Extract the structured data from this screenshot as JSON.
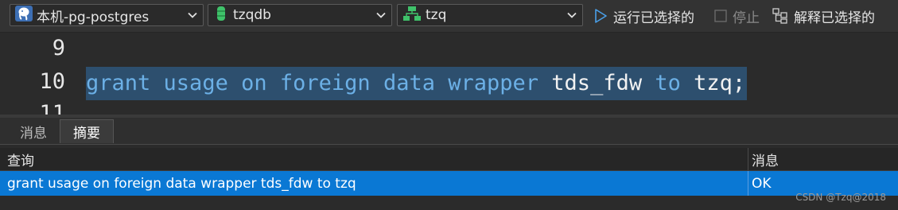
{
  "toolbar": {
    "connection": {
      "label": "本机-pg-postgres",
      "icon": "postgres-elephant-icon"
    },
    "database": {
      "label": "tzqdb",
      "icon": "database-icon",
      "icon_color": "#3fc26a"
    },
    "schema": {
      "label": "tzq",
      "icon": "schema-icon",
      "icon_color": "#3fc26a"
    },
    "run_selected_label": "运行已选择的",
    "stop_label": "停止",
    "explain_selected_label": "解释已选择的"
  },
  "editor": {
    "lines": [
      {
        "number": "9",
        "text": ""
      },
      {
        "number": "10",
        "text": "grant usage on foreign data wrapper tds_fdw to tzq;"
      },
      {
        "number": "11",
        "text": ""
      }
    ],
    "tokens": [
      {
        "text": "grant",
        "kind": "keyword"
      },
      {
        "text": " ",
        "kind": "space"
      },
      {
        "text": "usage",
        "kind": "keyword"
      },
      {
        "text": " ",
        "kind": "space"
      },
      {
        "text": "on",
        "kind": "keyword"
      },
      {
        "text": " ",
        "kind": "space"
      },
      {
        "text": "foreign",
        "kind": "keyword"
      },
      {
        "text": " ",
        "kind": "space"
      },
      {
        "text": "data",
        "kind": "keyword"
      },
      {
        "text": " ",
        "kind": "space"
      },
      {
        "text": "wrapper",
        "kind": "keyword"
      },
      {
        "text": " ",
        "kind": "space"
      },
      {
        "text": "tds_fdw",
        "kind": "identifier"
      },
      {
        "text": " ",
        "kind": "space"
      },
      {
        "text": "to",
        "kind": "keyword"
      },
      {
        "text": " ",
        "kind": "space"
      },
      {
        "text": "tzq;",
        "kind": "identifier"
      }
    ],
    "keyword_color": "#6cb0e6",
    "selection_color": "#2d4f6e"
  },
  "results": {
    "tabs": [
      {
        "label": "消息",
        "active": false
      },
      {
        "label": "摘要",
        "active": true
      }
    ],
    "columns": [
      "查询",
      "消息"
    ],
    "rows": [
      {
        "query": "grant usage on foreign data wrapper tds_fdw to tzq",
        "message": "OK",
        "selected": true
      }
    ],
    "selected_row_color": "#0a78d4"
  },
  "watermark": "CSDN @Tzq@2018"
}
